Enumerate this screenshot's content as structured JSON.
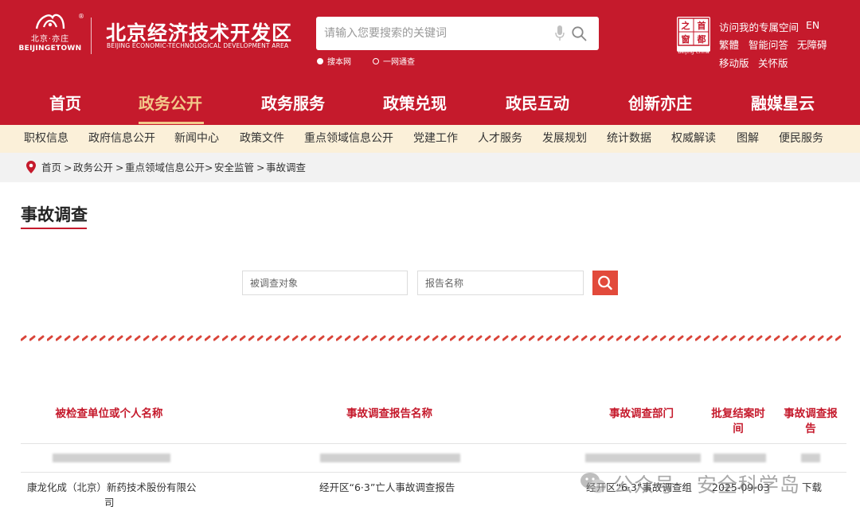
{
  "header": {
    "logo_cn": "北京·亦庄",
    "logo_en": "BEIJINGETOWN",
    "logo_reg": "®",
    "title": "北京经济技术开发区",
    "subtitle": "BEIJING ECONOMIC-TECHNOLOGICAL DEVELOPMENT AREA",
    "search_placeholder": "请输入您要搜索的关键词",
    "scope_options": [
      {
        "label": "搜本网",
        "selected": true
      },
      {
        "label": "一网通查",
        "selected": false
      }
    ],
    "capital_logo_chars": [
      "之",
      "首",
      "窗",
      "都"
    ],
    "capital_logo_caption": "Beijing·China",
    "quick_links": [
      "访问我的专属空间",
      "EN",
      "繁體",
      "智能问答",
      "无障碍",
      "移动版",
      "关怀版"
    ]
  },
  "main_nav": {
    "items": [
      "首页",
      "政务公开",
      "政务服务",
      "政策兑现",
      "政民互动",
      "创新亦庄",
      "融媒星云"
    ],
    "active_index": 1
  },
  "sub_nav": {
    "items": [
      "职权信息",
      "政府信息公开",
      "新闻中心",
      "政策文件",
      "重点领域信息公开",
      "党建工作",
      "人才服务",
      "发展规划",
      "统计数据",
      "权威解读",
      "图解",
      "便民服务"
    ]
  },
  "breadcrumb": {
    "items": [
      "首页",
      "政务公开",
      "重点领域信息公开",
      "安全监管",
      "事故调查"
    ],
    "separator": ">"
  },
  "page": {
    "title": "事故调查"
  },
  "filters": {
    "target_placeholder": "被调查对象",
    "report_placeholder": "报告名称"
  },
  "table": {
    "headers": {
      "entity": "被检查单位或个人名称",
      "report": "事故调查报告名称",
      "dept": "事故调查部门",
      "date": "批复结案时间",
      "download_1": "事故调查报",
      "download_2": "告"
    },
    "rows": [
      {
        "entity_1": "康龙化成（北京）新药技术股份有限公",
        "entity_2": "司",
        "report": "经开区“6·3”亡人事故调查报告",
        "dept": "经开区“6·3”事故调查组",
        "date": "2025-09-03",
        "download": "下载"
      }
    ]
  },
  "watermark": {
    "label": "公众号 · 安全科学岛"
  },
  "colors": {
    "brand_red": "#c51a2c",
    "nav_active": "#f3c98a",
    "sub_nav_bg": "#fbf0d9",
    "search_button": "#e24a3b"
  }
}
